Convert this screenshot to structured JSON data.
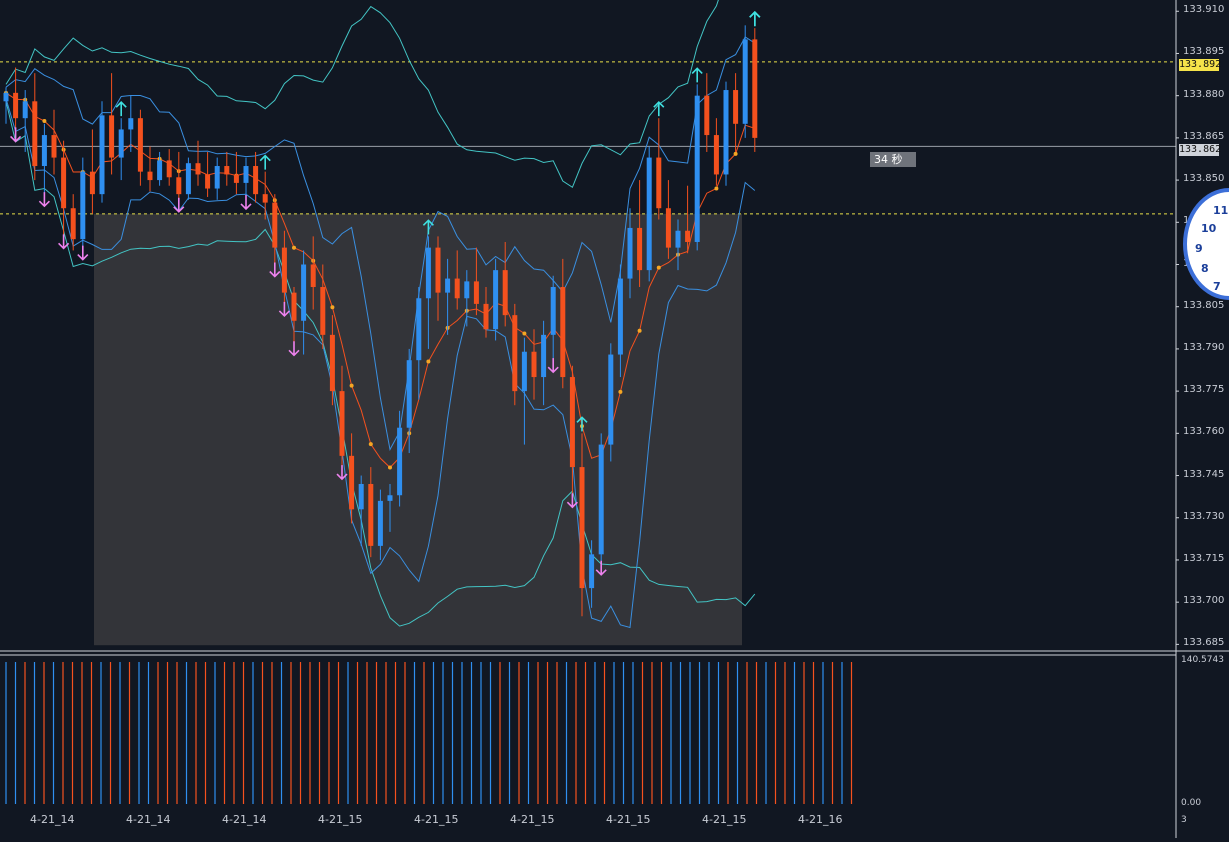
{
  "chart_data": {
    "type": "candlestick",
    "price_axis": {
      "ticks": [
        "133.910",
        "133.895",
        "133.880",
        "133.865",
        "133.850",
        "133.835",
        "133.820",
        "133.805",
        "133.790",
        "133.775",
        "133.760",
        "133.745",
        "133.730",
        "133.715",
        "133.700",
        "133.685"
      ],
      "tick_values": [
        133.91,
        133.895,
        133.88,
        133.865,
        133.85,
        133.835,
        133.82,
        133.805,
        133.79,
        133.775,
        133.76,
        133.745,
        133.73,
        133.715,
        133.7,
        133.685
      ],
      "ylim": [
        133.683,
        133.914
      ]
    },
    "time_axis": {
      "labels": [
        "4-21_14",
        "4-21_14",
        "4-21_14",
        "4-21_15",
        "4-21_15",
        "4-21_15",
        "4-21_15",
        "4-21_15",
        "4-21_16"
      ]
    },
    "price_tags": {
      "upper_level": "133.892",
      "current": "133.862"
    },
    "levels": {
      "upper": 133.892,
      "lower": 133.838,
      "current": 133.862
    },
    "countdown": "34 秒",
    "volume_axis": {
      "top": "140.5743",
      "bottom_a": "0.00",
      "bottom_b": "3"
    },
    "series": [
      {
        "name": "up",
        "color": "#2f8ff0"
      },
      {
        "name": "down",
        "color": "#f4511e"
      }
    ],
    "candles": [
      [
        133.878,
        133.883,
        133.87,
        133.881
      ],
      [
        133.881,
        133.89,
        133.868,
        133.872
      ],
      [
        133.872,
        133.882,
        133.86,
        133.878
      ],
      [
        133.878,
        133.888,
        133.85,
        133.855
      ],
      [
        133.855,
        133.87,
        133.845,
        133.866
      ],
      [
        133.866,
        133.875,
        133.852,
        133.858
      ],
      [
        133.858,
        133.864,
        133.83,
        133.84
      ],
      [
        133.84,
        133.845,
        133.825,
        133.829
      ],
      [
        133.829,
        133.858,
        133.826,
        133.853
      ],
      [
        133.853,
        133.868,
        133.838,
        133.845
      ],
      [
        133.845,
        133.878,
        133.842,
        133.873
      ],
      [
        133.873,
        133.888,
        133.852,
        133.858
      ],
      [
        133.858,
        133.872,
        133.85,
        133.868
      ],
      [
        133.868,
        133.88,
        133.86,
        133.872
      ],
      [
        133.872,
        133.875,
        133.848,
        133.853
      ],
      [
        133.853,
        133.862,
        133.846,
        133.85
      ],
      [
        133.85,
        133.86,
        133.848,
        133.857
      ],
      [
        133.857,
        133.861,
        133.848,
        133.851
      ],
      [
        133.851,
        133.86,
        133.843,
        133.845
      ],
      [
        133.845,
        133.858,
        133.843,
        133.856
      ],
      [
        133.856,
        133.864,
        133.848,
        133.852
      ],
      [
        133.852,
        133.86,
        133.844,
        133.847
      ],
      [
        133.847,
        133.858,
        133.843,
        133.855
      ],
      [
        133.855,
        133.86,
        133.848,
        133.852
      ],
      [
        133.852,
        133.86,
        133.845,
        133.849
      ],
      [
        133.849,
        133.858,
        133.844,
        133.855
      ],
      [
        133.855,
        133.86,
        133.842,
        133.845
      ],
      [
        133.845,
        133.853,
        133.836,
        133.842
      ],
      [
        133.842,
        133.845,
        133.82,
        133.826
      ],
      [
        133.826,
        133.832,
        133.806,
        133.81
      ],
      [
        133.81,
        133.812,
        133.792,
        133.8
      ],
      [
        133.8,
        133.825,
        133.788,
        133.82
      ],
      [
        133.82,
        133.83,
        133.804,
        133.812
      ],
      [
        133.812,
        133.82,
        133.79,
        133.795
      ],
      [
        133.795,
        133.802,
        133.77,
        133.775
      ],
      [
        133.775,
        133.784,
        133.748,
        133.752
      ],
      [
        133.752,
        133.76,
        133.728,
        133.733
      ],
      [
        133.733,
        133.745,
        133.72,
        133.742
      ],
      [
        133.742,
        133.748,
        133.716,
        133.72
      ],
      [
        133.72,
        133.74,
        133.715,
        133.736
      ],
      [
        133.736,
        133.742,
        133.725,
        133.738
      ],
      [
        133.738,
        133.768,
        133.734,
        133.762
      ],
      [
        133.762,
        133.79,
        133.753,
        133.786
      ],
      [
        133.786,
        133.812,
        133.772,
        133.808
      ],
      [
        133.808,
        133.83,
        133.79,
        133.826
      ],
      [
        133.826,
        133.83,
        133.8,
        133.81
      ],
      [
        133.81,
        133.822,
        133.795,
        133.815
      ],
      [
        133.815,
        133.825,
        133.804,
        133.808
      ],
      [
        133.808,
        133.818,
        133.798,
        133.814
      ],
      [
        133.814,
        133.826,
        133.802,
        133.806
      ],
      [
        133.806,
        133.812,
        133.794,
        133.797
      ],
      [
        133.797,
        133.822,
        133.793,
        133.818
      ],
      [
        133.818,
        133.828,
        133.798,
        133.802
      ],
      [
        133.802,
        133.806,
        133.77,
        133.775
      ],
      [
        133.775,
        133.794,
        133.756,
        133.789
      ],
      [
        133.789,
        133.797,
        133.772,
        133.78
      ],
      [
        133.78,
        133.8,
        133.77,
        133.795
      ],
      [
        133.795,
        133.816,
        133.786,
        133.812
      ],
      [
        133.812,
        133.822,
        133.776,
        133.78
      ],
      [
        133.78,
        133.784,
        133.738,
        133.748
      ],
      [
        133.748,
        133.76,
        133.695,
        133.705
      ],
      [
        133.705,
        133.722,
        133.698,
        133.717
      ],
      [
        133.717,
        133.76,
        133.714,
        133.756
      ],
      [
        133.756,
        133.792,
        133.75,
        133.788
      ],
      [
        133.788,
        133.82,
        133.78,
        133.815
      ],
      [
        133.815,
        133.84,
        133.808,
        133.833
      ],
      [
        133.833,
        133.85,
        133.812,
        133.818
      ],
      [
        133.818,
        133.862,
        133.814,
        133.858
      ],
      [
        133.858,
        133.872,
        133.836,
        133.84
      ],
      [
        133.84,
        133.85,
        133.822,
        133.826
      ],
      [
        133.826,
        133.836,
        133.818,
        133.832
      ],
      [
        133.832,
        133.848,
        133.824,
        133.828
      ],
      [
        133.828,
        133.884,
        133.825,
        133.88
      ],
      [
        133.88,
        133.888,
        133.86,
        133.866
      ],
      [
        133.866,
        133.872,
        133.848,
        133.852
      ],
      [
        133.852,
        133.885,
        133.848,
        133.882
      ],
      [
        133.882,
        133.888,
        133.86,
        133.87
      ],
      [
        133.87,
        133.905,
        133.865,
        133.9
      ],
      [
        133.9,
        133.904,
        133.86,
        133.865
      ]
    ]
  }
}
